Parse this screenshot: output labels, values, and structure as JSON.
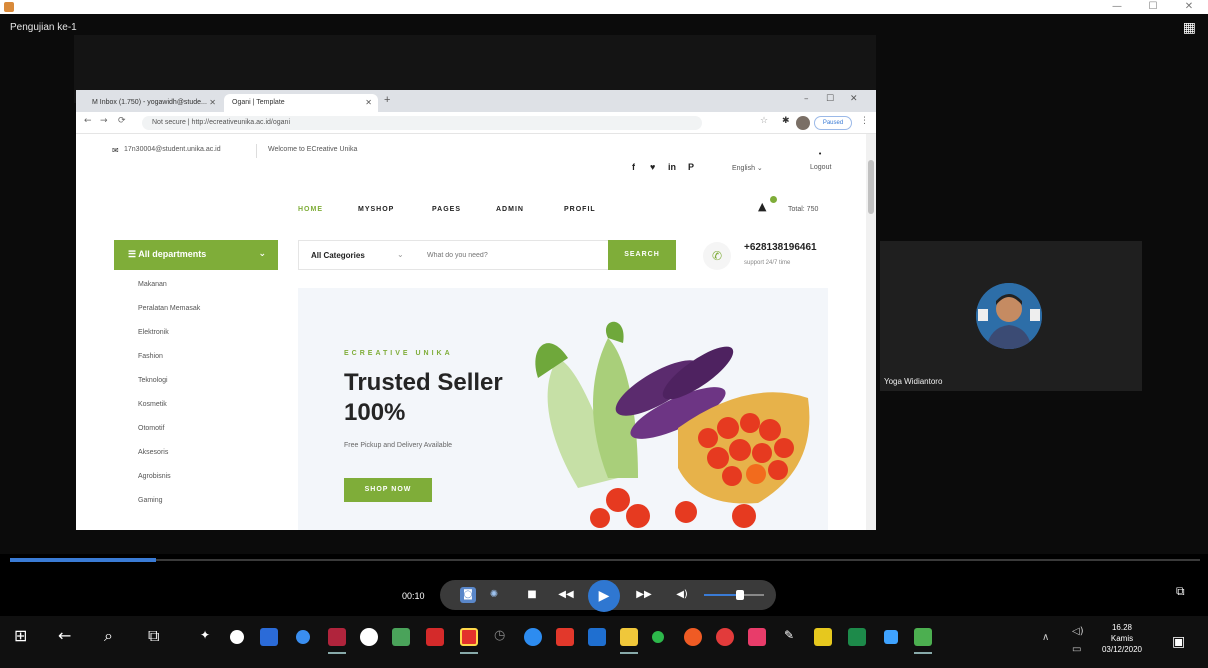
{
  "window": {
    "min": "—",
    "max": "☐",
    "close": "✕"
  },
  "video": {
    "title": "Pengujian ke-1",
    "grid_icon": "grid-icon",
    "progress_fraction": 0.123
  },
  "browser": {
    "tabs": [
      {
        "label": "M Inbox (1.750) - yogawidh@stude...",
        "active": false
      },
      {
        "label": "Ogani | Template",
        "active": true
      }
    ],
    "new_tab": "+",
    "url": "Not secure | http://ecreativeunika.ac.id/ogani",
    "nav_icons": [
      "←",
      "→",
      "⟳"
    ],
    "profile_label": "Paused"
  },
  "site": {
    "email": "17n30004@student.unika.ac.id",
    "welcome": "Welcome to ECreative Unika",
    "social": [
      "f",
      "♥",
      "in",
      "P"
    ],
    "language": "English ⌄",
    "login": "Logout",
    "nav": [
      "HOME",
      "MYSHOP",
      "PAGES",
      "ADMIN",
      "PROFIL"
    ],
    "cart_total": "Total: 750",
    "departments_label": "☰  All departments",
    "departments": [
      "Makanan",
      "Peralatan Memasak",
      "Elektronik",
      "Fashion",
      "Teknologi",
      "Kosmetik",
      "Otomotif",
      "Aksesoris",
      "Agrobisnis",
      "Gaming"
    ],
    "search": {
      "category": "All Categories",
      "placeholder": "What do you need?",
      "button": "SEARCH"
    },
    "phone": "+628138196461",
    "support": "support 24/7 time",
    "hero": {
      "kicker": "ECREATIVE UNIKA",
      "title": "Trusted Seller 100%",
      "subtitle": "Free Pickup and Delivery Available",
      "button": "SHOP NOW"
    }
  },
  "participant": {
    "name": "Yoga Widiantoro"
  },
  "player": {
    "time": "00:10",
    "volume_fraction": 0.6
  },
  "taskbar": {
    "time": "16.28",
    "day": "Kamis",
    "date": "03/12/2020"
  }
}
